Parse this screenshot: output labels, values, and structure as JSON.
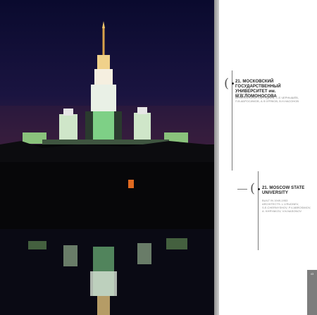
{
  "ru": {
    "number_title": "21. МОСКОВСКИЙ ГОСУДАРСТВЕННЫЙ",
    "title_line2": "УНИВЕРСИТЕТ им. М.В.ЛОМОНОСОВА",
    "years": "1949-1953",
    "architects_line1": "АРХИТЕКТОРЫ: Л.В.РУДНЕВ, С.Е.ЧЕРНЫШЁВ,",
    "architects_line2": "П.В.АБРОСИМОВ, А.Ф.ХРЯКОВ, В.Н.НАСОНОВ"
  },
  "en": {
    "number_title": "21. MOSCOW STATE",
    "title_line2": "UNIVERSITY",
    "built": "BUILT IN 1949-1953",
    "line1": "ARCHITECTS: L.V.RUDNEV,",
    "line2": "S.E.CHERNYSHOV, P.V.ABROSIMOV,",
    "line3": "A. KHRYAKOV, V.N.NASONOV"
  },
  "page_tab": {
    "number": "43"
  }
}
